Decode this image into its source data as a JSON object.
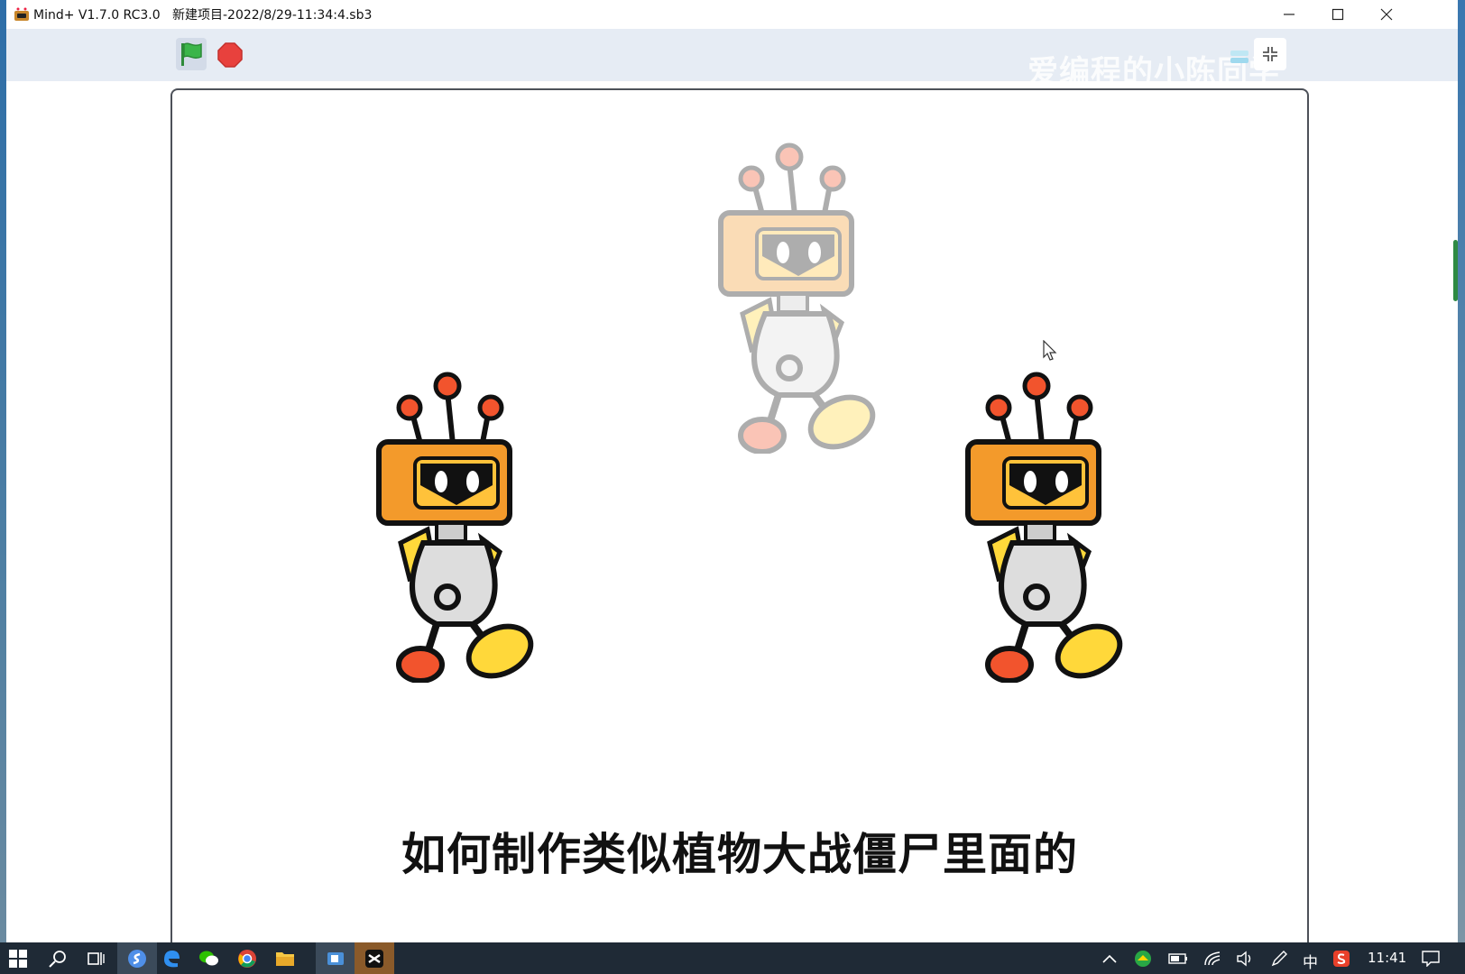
{
  "window": {
    "app_name": "Mind+ V1.7.0 RC3.0",
    "file_name": "新建项目-2022/8/29-11:34:4.sb3"
  },
  "toolbar": {
    "watermark": "爱编程的小陈同学"
  },
  "stage": {
    "subtitle": "如何制作类似植物大战僵尸里面的"
  },
  "taskbar": {
    "ime_label": "中",
    "clock": "11:41"
  },
  "colors": {
    "robot_orange": "#f39a2b",
    "robot_yellow": "#ffd83a",
    "antenna_red": "#f2542d",
    "flag_green": "#3bb54a",
    "stop_red": "#e8413d"
  },
  "icons": [
    "app-icon",
    "minimize-icon",
    "maximize-icon",
    "close-icon",
    "green-flag-icon",
    "stop-icon",
    "layout-icon",
    "shrink-icon",
    "windows-start-icon",
    "search-icon",
    "task-view-icon",
    "browser-icon",
    "edge-icon",
    "wechat-icon",
    "chrome-icon",
    "file-explorer-icon",
    "app-icon",
    "capcut-icon",
    "chevron-up-icon",
    "tray-app-icon",
    "battery-icon",
    "wifi-icon",
    "volume-icon",
    "pen-icon",
    "sogou-icon",
    "notification-icon"
  ]
}
